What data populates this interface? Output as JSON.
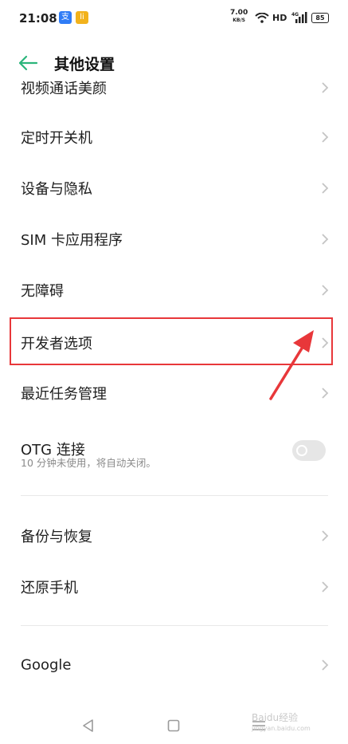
{
  "status_bar": {
    "time": "21:08",
    "app_icon_1": "支",
    "app_icon_2": "li",
    "net_speed": "7.00",
    "net_speed_unit": "KB/S",
    "hd": "HD",
    "signal_label": "4G",
    "battery": "85"
  },
  "header": {
    "title": "其他设置",
    "back_icon": "arrow-left-icon",
    "accent_color": "#2bb57b"
  },
  "list": {
    "partial_item": "视频通话美颜",
    "items": [
      {
        "label": "定时开关机"
      },
      {
        "label": "设备与隐私"
      },
      {
        "label": "SIM 卡应用程序"
      },
      {
        "label": "无障碍"
      },
      {
        "label": "开发者选项"
      },
      {
        "label": "最近任务管理"
      }
    ],
    "otg": {
      "label": "OTG 连接",
      "sub": "10 分钟未使用，将自动关闭。",
      "enabled": false
    },
    "group2": [
      {
        "label": "备份与恢复"
      },
      {
        "label": "还原手机"
      }
    ],
    "group3": [
      {
        "label": "Google"
      }
    ]
  },
  "annotation": {
    "highlight_color": "#e8373a"
  },
  "watermark": {
    "text": "Baidu经验",
    "sub": "jingyan.baidu.com"
  }
}
